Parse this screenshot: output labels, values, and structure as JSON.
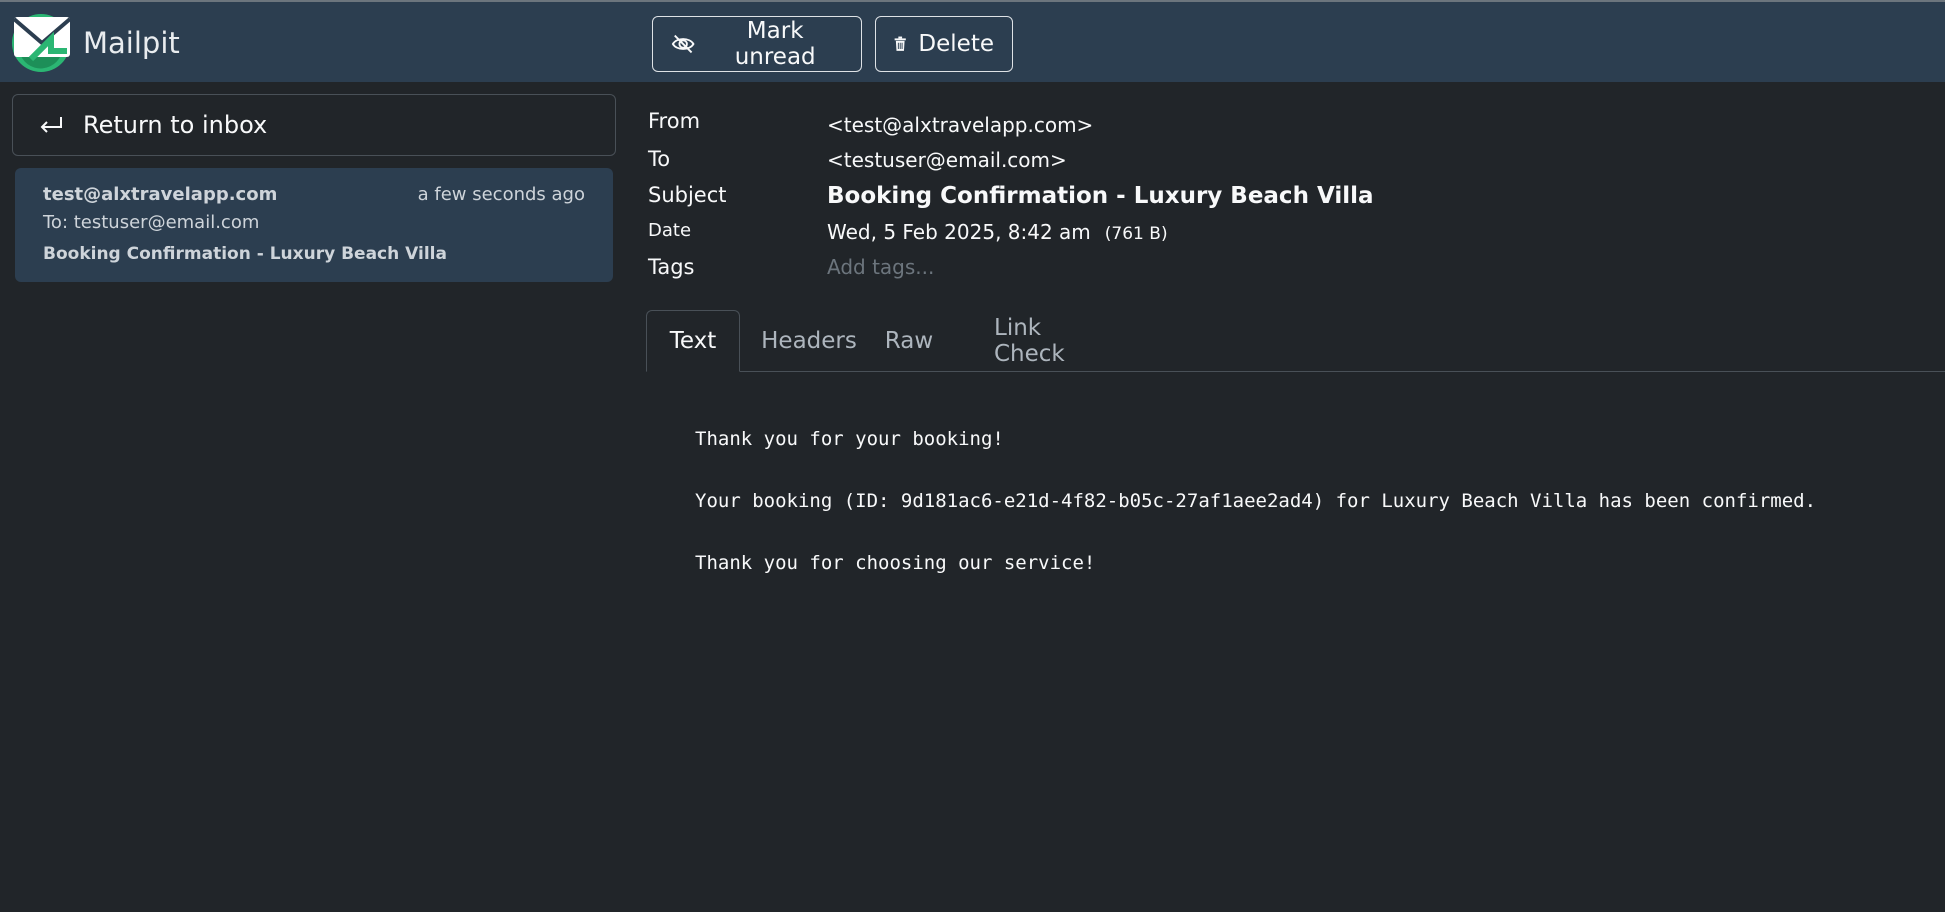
{
  "app": {
    "name": "Mailpit"
  },
  "toolbar": {
    "mark_unread": "Mark unread",
    "delete": "Delete"
  },
  "sidebar": {
    "return_label": "Return to inbox",
    "message": {
      "from": "test@alxtravelapp.com",
      "time": "a few seconds ago",
      "to": "To: testuser@email.com",
      "subject": "Booking Confirmation - Luxury Beach Villa"
    }
  },
  "headers": {
    "from_label": "From",
    "from_value": "<test@alxtravelapp.com>",
    "to_label": "To",
    "to_value": "<testuser@email.com>",
    "subject_label": "Subject",
    "subject_value": "Booking Confirmation - Luxury Beach Villa",
    "date_label": "Date",
    "date_value": "Wed, 5 Feb 2025, 8:42 am",
    "size": "(761 B)",
    "tags_label": "Tags",
    "tags_placeholder": "Add tags..."
  },
  "tabs": [
    {
      "label": "Text"
    },
    {
      "label": "Headers"
    },
    {
      "label": "Raw"
    },
    {
      "label": "Link Check"
    }
  ],
  "body": {
    "line1": "Thank you for your booking!",
    "line2": "Your booking (ID: 9d181ac6-e21d-4f82-b05c-27af1aee2ad4) for Luxury Beach Villa has been confirmed.",
    "line3": "Thank you for choosing our service!"
  },
  "colors": {
    "topbar": "#2c3e50",
    "background": "#212529",
    "logo_green": "#2bb673"
  },
  "icons": {
    "logo": "mailpit-logo-icon",
    "mark_unread": "eye-slash-icon",
    "delete": "trash-icon",
    "return": "return-arrow-icon"
  }
}
